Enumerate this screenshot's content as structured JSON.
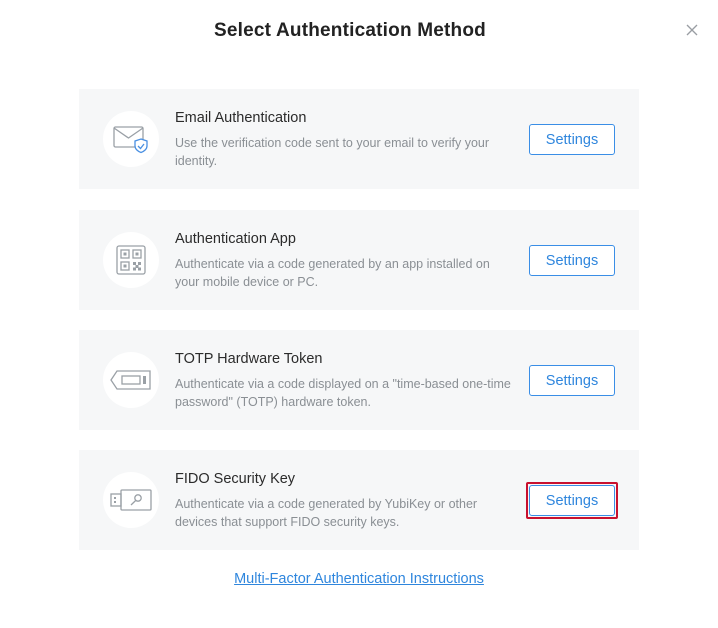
{
  "dialog": {
    "title": "Select Authentication Method"
  },
  "methods": [
    {
      "title": "Email Authentication",
      "description": "Use the verification code sent to your email to verify your identity.",
      "button_label": "Settings",
      "icon": "email-shield-icon"
    },
    {
      "title": "Authentication App",
      "description": "Authenticate via a code generated by an app installed on your mobile device or PC.",
      "button_label": "Settings",
      "icon": "qr-code-icon"
    },
    {
      "title": "TOTP Hardware Token",
      "description": "Authenticate via a code displayed on a \"time-based one-time password\" (TOTP) hardware token.",
      "button_label": "Settings",
      "icon": "hardware-token-icon"
    },
    {
      "title": "FIDO Security Key",
      "description": "Authenticate via a code generated by YubiKey or other devices that support FIDO security keys.",
      "button_label": "Settings",
      "icon": "security-key-icon"
    }
  ],
  "footer": {
    "link_label": "Multi-Factor Authentication Instructions"
  },
  "colors": {
    "accent": "#2f86dd",
    "card_bg": "#f6f7f8",
    "highlight": "#c8102e"
  }
}
